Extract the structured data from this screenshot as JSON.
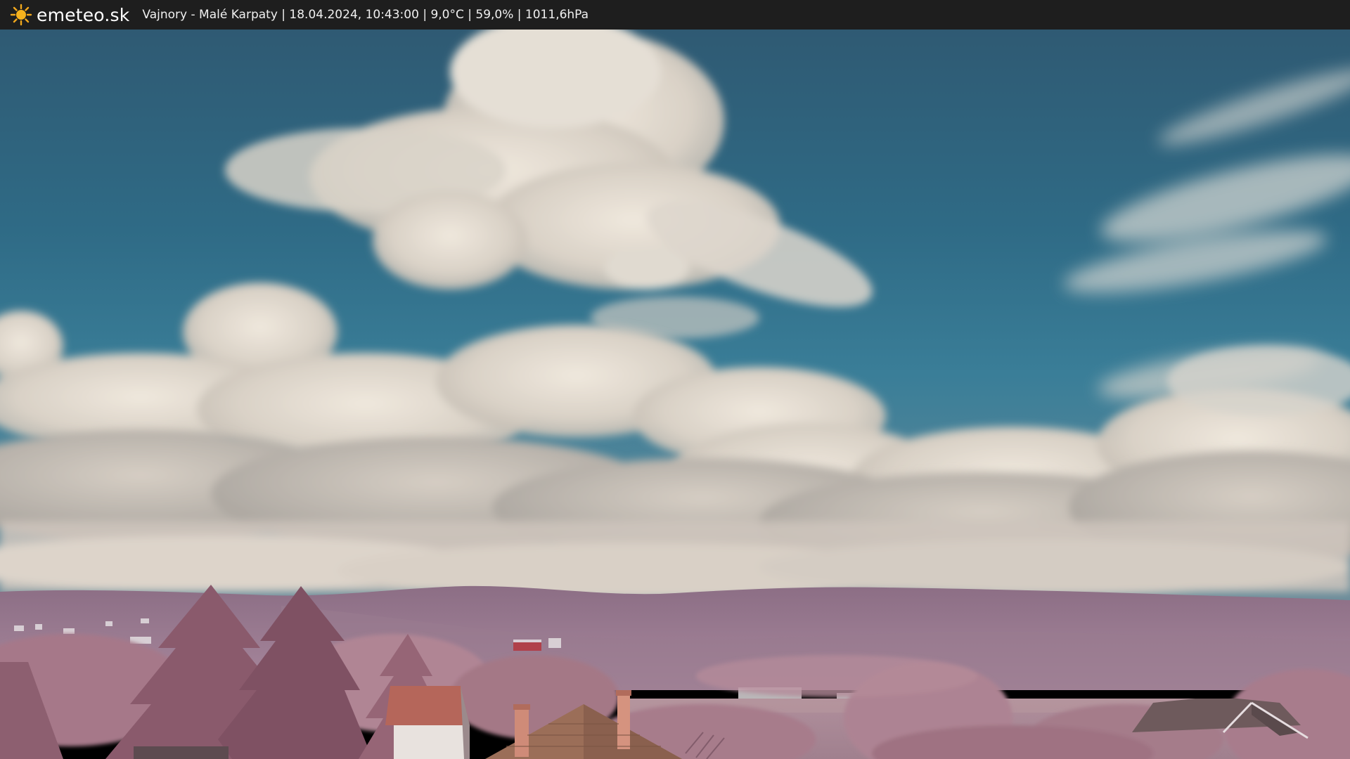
{
  "header": {
    "brand": "emeteo.sk",
    "info": "Vajnory - Malé Karpaty | 18.04.2024, 10:43:00 | 9,0°C | 59,0% | 1011,6hPa",
    "icon": "sun-icon"
  },
  "colors": {
    "bar": "#1e1e1e",
    "sky_top": "#2f5a73",
    "sky_mid": "#2e7592",
    "cloud": "#e6ded3",
    "hills": "#a27f98",
    "foliage": "#a97a8a",
    "roof": "#b16a58",
    "sun": "#f2a81c"
  }
}
